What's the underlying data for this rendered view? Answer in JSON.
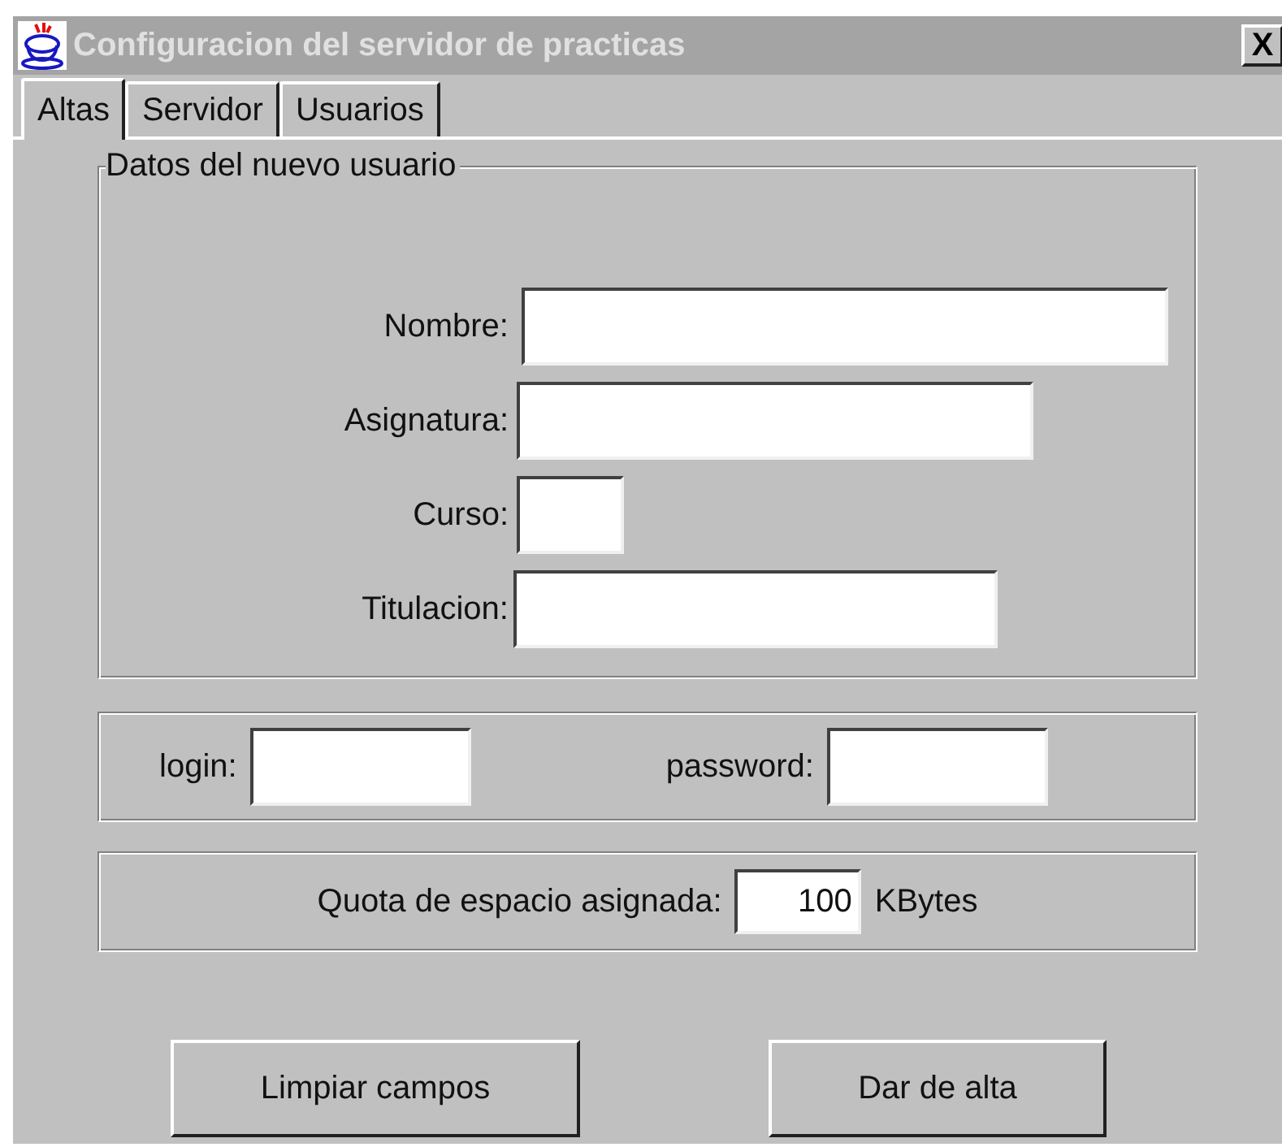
{
  "window": {
    "title": "Configuracion del servidor de practicas",
    "close": "X"
  },
  "tabs": [
    {
      "label": "Altas",
      "selected": true
    },
    {
      "label": "Servidor",
      "selected": false
    },
    {
      "label": "Usuarios",
      "selected": false
    }
  ],
  "group": {
    "title": "Datos del nuevo usuario",
    "fields": [
      {
        "label": "Nombre:"
      },
      {
        "label": "Asignatura:"
      },
      {
        "label": "Curso:"
      },
      {
        "label": "Titulacion:"
      }
    ]
  },
  "credentials": [
    {
      "label": "login:"
    },
    {
      "label": "password:"
    }
  ],
  "quota": {
    "label": "Quota de espacio asignada:",
    "value": "100",
    "unit": "KBytes"
  },
  "buttons": [
    "Limpiar campos",
    "Dar de alta"
  ]
}
